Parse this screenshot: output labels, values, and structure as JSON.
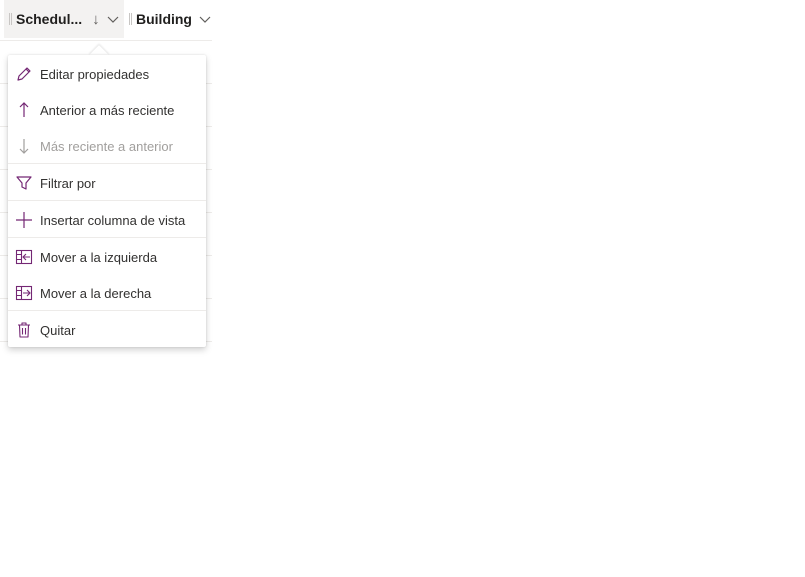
{
  "columns": {
    "scheduled": {
      "label": "Schedul...",
      "sort_icon": "↓",
      "menu_icon": "chevron-down-icon"
    },
    "building": {
      "label": "Building",
      "menu_icon": "chevron-down-icon"
    }
  },
  "menu": {
    "items": [
      {
        "label": "Editar propiedades",
        "icon": "pencil-icon",
        "enabled": true
      },
      {
        "label": "Anterior a más reciente",
        "icon": "arrow-up-icon",
        "enabled": true
      },
      {
        "label": "Más reciente a anterior",
        "icon": "arrow-down-icon",
        "enabled": false
      },
      {
        "label": "Filtrar por",
        "icon": "filter-icon",
        "enabled": true
      },
      {
        "label": "Insertar columna de vista",
        "icon": "plus-icon",
        "enabled": true
      },
      {
        "label": "Mover a la izquierda",
        "icon": "move-left-icon",
        "enabled": true
      },
      {
        "label": "Mover a la derecha",
        "icon": "move-right-icon",
        "enabled": true
      },
      {
        "label": "Quitar",
        "icon": "trash-icon",
        "enabled": true
      }
    ]
  },
  "colors": {
    "accent": "#742774",
    "disabled": "#a19f9d",
    "text": "#323130"
  }
}
